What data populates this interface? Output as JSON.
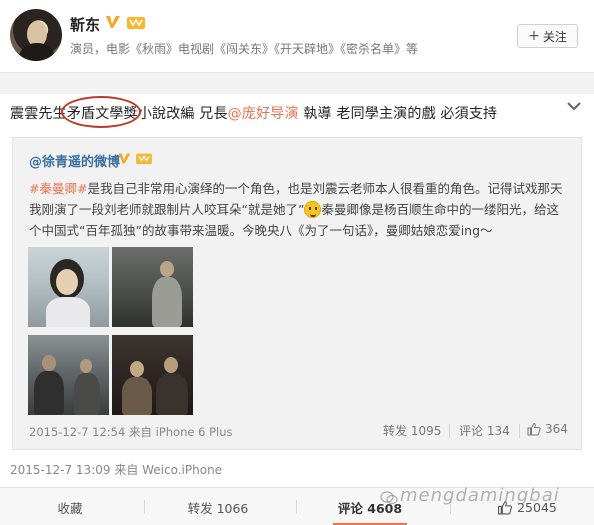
{
  "profile": {
    "username": "靳东",
    "bio": "演员，电影《秋雨》电视剧《闯关东》《开天辟地》《密杀名单》等",
    "follow_label": "关注"
  },
  "post": {
    "text_1": "震雲先生",
    "text_2": "矛盾文學獎",
    "text_3": "小說改編  兄長",
    "mention_1": "@庞好导演",
    "text_4": " 執導 老同學主演的戲 必須支持",
    "meta": "2015-12-7 13:09 来自 Weico.iPhone"
  },
  "repost": {
    "user": "@徐青遥的微博",
    "tag": "#秦曼卿#",
    "body_1": "是我自己非常用心演绎的一个角色，也是刘震云老师本人很看重的角色。记得试戏那天我刚演了一段刘老师就跟制片人咬耳朵“就是她了”",
    "body_2": "秦曼卿像是杨百顺生命中的一缕阳光，给这个中国式“百年孤独”的故事带来温暖。今晚央八《为了一句话》，曼卿姑娘恋爱ing～",
    "meta": "2015-12-7 12:54 来自 iPhone 6 Plus",
    "forward_label": "转发 1095",
    "comment_label": "评论 134",
    "like_count": "364"
  },
  "actions": {
    "favorite": "收藏",
    "forward": "转发 1066",
    "comment": "评论 4608",
    "like": "25045"
  },
  "watermark": "mengdamingbai",
  "colors": {
    "accent": "#eb7350",
    "link": "#3a6fa3",
    "highlight_oval": "#c0392b"
  }
}
